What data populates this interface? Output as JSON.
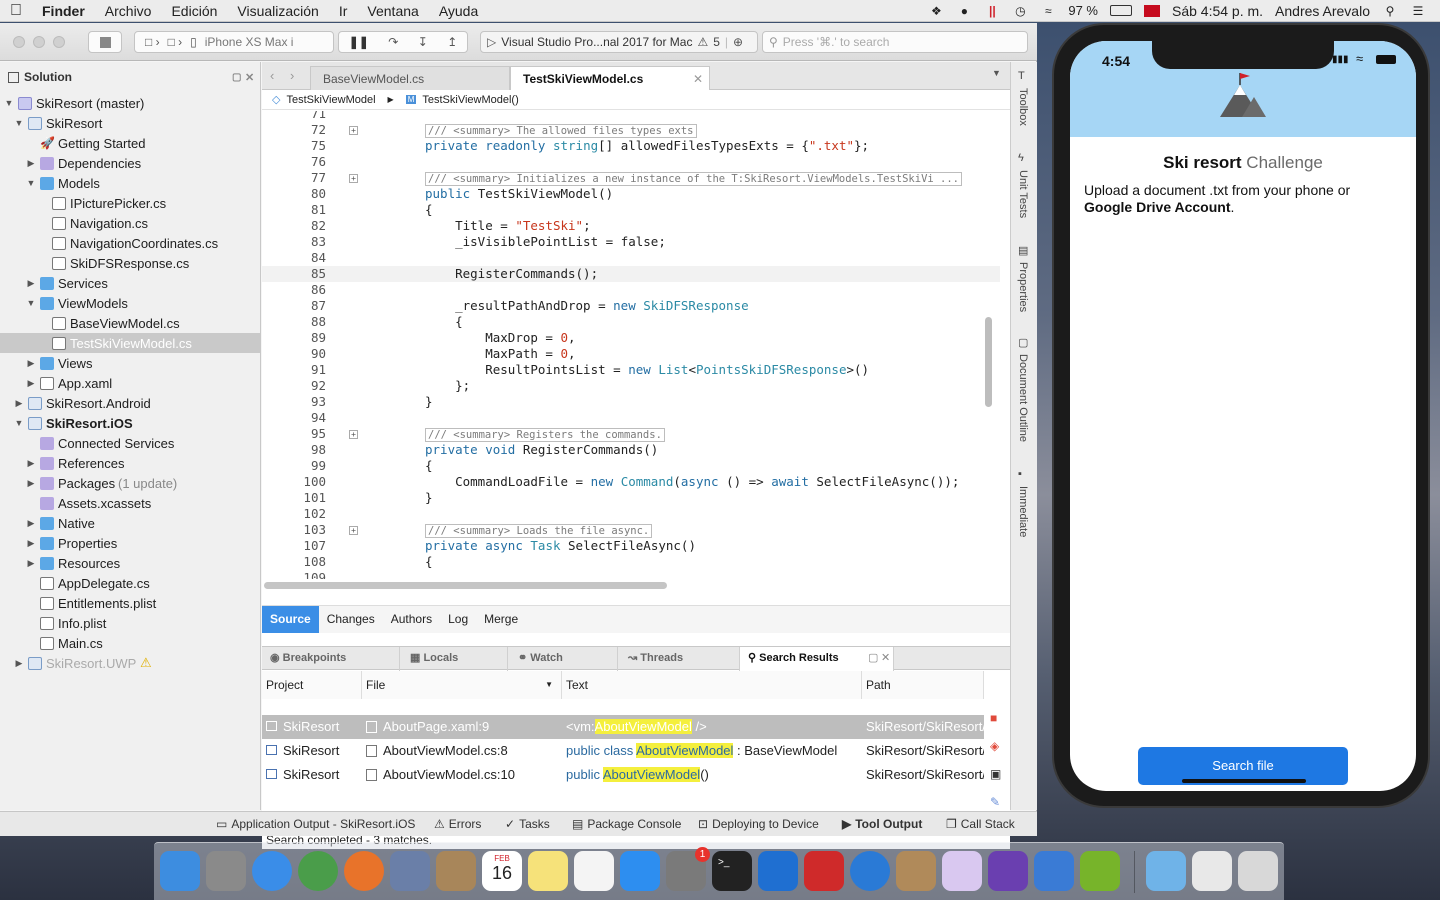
{
  "menubar": {
    "apple": "",
    "app": "Finder",
    "items": [
      "Archivo",
      "Edición",
      "Visualización",
      "Ir",
      "Ventana",
      "Ayuda"
    ],
    "battery": "97 %",
    "datetime": "Sáb 4:54 p. m.",
    "user": "Andres Arevalo"
  },
  "toolbar": {
    "device": "iPhone XS Max i",
    "status": "Visual Studio Pro...nal 2017 for Mac",
    "warnings": "5",
    "search_placeholder": "Press '⌘.' to search"
  },
  "solution": {
    "header": "Solution",
    "items": [
      {
        "label": "SkiResort (master)"
      },
      {
        "label": "SkiResort"
      },
      {
        "label": "Getting Started"
      },
      {
        "label": "Dependencies"
      },
      {
        "label": "Models"
      },
      {
        "label": "IPicturePicker.cs"
      },
      {
        "label": "Navigation.cs"
      },
      {
        "label": "NavigationCoordinates.cs"
      },
      {
        "label": "SkiDFSResponse.cs"
      },
      {
        "label": "Services"
      },
      {
        "label": "ViewModels"
      },
      {
        "label": "BaseViewModel.cs"
      },
      {
        "label": "TestSkiViewModel.cs"
      },
      {
        "label": "Views"
      },
      {
        "label": "App.xaml"
      },
      {
        "label": "SkiResort.Android"
      },
      {
        "label": "SkiResort.iOS"
      },
      {
        "label": "Connected Services"
      },
      {
        "label": "References"
      },
      {
        "label": "Packages",
        "extra": "(1 update)"
      },
      {
        "label": "Assets.xcassets"
      },
      {
        "label": "Native"
      },
      {
        "label": "Properties"
      },
      {
        "label": "Resources"
      },
      {
        "label": "AppDelegate.cs"
      },
      {
        "label": "Entitlements.plist"
      },
      {
        "label": "Info.plist"
      },
      {
        "label": "Main.cs"
      },
      {
        "label": "SkiResort.UWP"
      }
    ]
  },
  "editor": {
    "tabs": [
      "BaseViewModel.cs",
      "TestSkiViewModel.cs"
    ],
    "breadcrumb": [
      "TestSkiViewModel",
      "TestSkiViewModel()"
    ],
    "lines": [
      {
        "n": "71",
        "t": ""
      },
      {
        "n": "72",
        "t": "/// <summary> The allowed files types exts",
        "comment": true
      },
      {
        "n": "75",
        "t": "private readonly string[] allowedFilesTypesExts = {\".txt\"};"
      },
      {
        "n": "76",
        "t": ""
      },
      {
        "n": "77",
        "t": "/// <summary> Initializes a new instance of the T:SkiResort.ViewModels.TestSkiVi ...",
        "comment": true
      },
      {
        "n": "80",
        "t": "public TestSkiViewModel()"
      },
      {
        "n": "81",
        "t": "{"
      },
      {
        "n": "82",
        "t": "    Title = \"TestSki\";"
      },
      {
        "n": "83",
        "t": "    _isVisiblePointList = false;"
      },
      {
        "n": "84",
        "t": ""
      },
      {
        "n": "85",
        "t": "    RegisterCommands();"
      },
      {
        "n": "86",
        "t": ""
      },
      {
        "n": "87",
        "t": "    _resultPathAndDrop = new SkiDFSResponse"
      },
      {
        "n": "88",
        "t": "    {"
      },
      {
        "n": "89",
        "t": "        MaxDrop = 0,"
      },
      {
        "n": "90",
        "t": "        MaxPath = 0,"
      },
      {
        "n": "91",
        "t": "        ResultPointsList = new List<PointsSkiDFSResponse>()"
      },
      {
        "n": "92",
        "t": "    };"
      },
      {
        "n": "93",
        "t": "}"
      },
      {
        "n": "94",
        "t": ""
      },
      {
        "n": "95",
        "t": "/// <summary> Registers the commands.",
        "comment": true
      },
      {
        "n": "98",
        "t": "private void RegisterCommands()"
      },
      {
        "n": "99",
        "t": "{"
      },
      {
        "n": "100",
        "t": "    CommandLoadFile = new Command(async () => await SelectFileAsync());"
      },
      {
        "n": "101",
        "t": "}"
      },
      {
        "n": "102",
        "t": ""
      },
      {
        "n": "103",
        "t": "/// <summary> Loads the file async.",
        "comment": true
      },
      {
        "n": "107",
        "t": "private async Task SelectFileAsync()"
      },
      {
        "n": "108",
        "t": "{"
      },
      {
        "n": "109",
        "t": ""
      }
    ]
  },
  "vcs_tabs": [
    "Source",
    "Changes",
    "Authors",
    "Log",
    "Merge"
  ],
  "pads": [
    "Breakpoints",
    "Locals",
    "Watch",
    "Threads",
    "Search Results"
  ],
  "search_results": {
    "columns": [
      "Project",
      "File",
      "Text",
      "Path"
    ],
    "rows": [
      {
        "project": "SkiResort",
        "file": "AboutPage.xaml:9",
        "pre": "<vm:",
        "match": "AboutViewModel",
        "post": " />",
        "path": "SkiResort/SkiResort/"
      },
      {
        "project": "SkiResort",
        "file": "AboutViewModel.cs:8",
        "pre": "public class ",
        "match": "AboutViewModel",
        "post": " : BaseViewModel",
        "path": "SkiResort/SkiResort/"
      },
      {
        "project": "SkiResort",
        "file": "AboutViewModel.cs:10",
        "pre": "public ",
        "match": "AboutViewModel",
        "post": "()",
        "path": "SkiResort/SkiResort/"
      }
    ],
    "status": "Search completed - 3 matches."
  },
  "right_pads": [
    "Toolbox",
    "Unit Tests",
    "Properties",
    "Document Outline",
    "Immediate"
  ],
  "statusbar": {
    "items": [
      "Application Output - SkiResort.iOS",
      "Errors",
      "Tasks",
      "Package Console",
      "Deploying to Device",
      "Tool Output",
      "Call Stack"
    ]
  },
  "simulator": {
    "time": "4:54",
    "title_bold": "Ski resort",
    "title_rest": " Challenge",
    "desc_pre": "Upload a document .txt from your phone or",
    "desc_bold": "Google Drive Account",
    "desc_post": ".",
    "button": "Search file"
  },
  "dock": {
    "calendar_month": "FEB",
    "calendar_day": "16",
    "badge": "1"
  },
  "colors": {
    "accent": "#3b8ee6",
    "sim_button": "#1e78e3",
    "sim_header": "#a6d6f5",
    "highlight": "#f4ef3d"
  }
}
